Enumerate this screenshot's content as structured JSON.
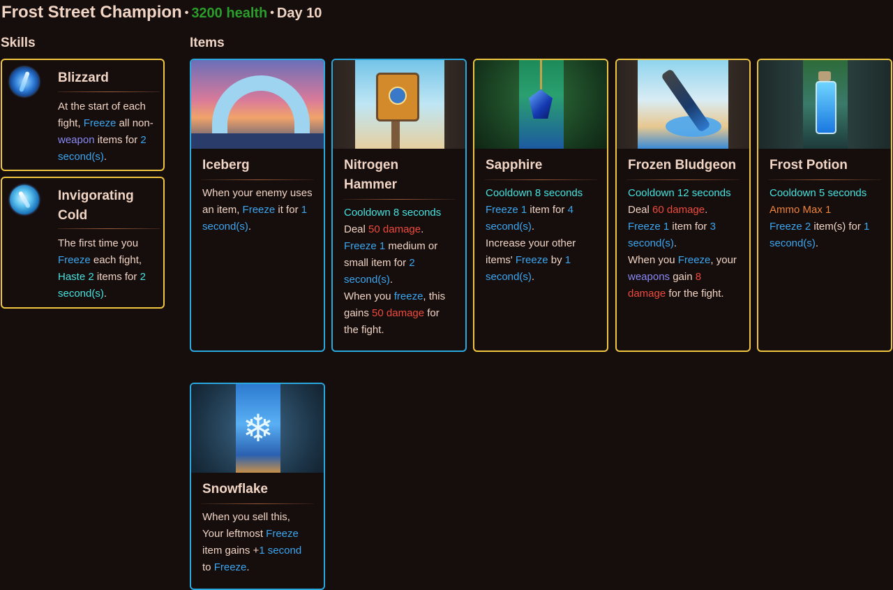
{
  "header": {
    "name": "Frost Street Champion",
    "separator": "•",
    "health": "3200 health",
    "day": "Day 10"
  },
  "colors": {
    "background": "#160d0d",
    "text": "#f1d5c5",
    "health": "#2a9d2a",
    "border_blue": "#29a9e0",
    "border_gold": "#f1c641",
    "freeze": "#3ba7f0",
    "cooldown": "#46e3e0",
    "damage": "#ef4b3c",
    "weapon": "#8a8af6",
    "ammo": "#f0843a"
  },
  "skills_label": "Skills",
  "items_label": "Items",
  "skills": [
    {
      "title": "Blizzard",
      "icon": "blizzard-icon",
      "desc": [
        {
          "t": "At the start of each fight, "
        },
        {
          "t": "Freeze",
          "c": "k-freeze"
        },
        {
          "t": " all non-"
        },
        {
          "t": "weapon",
          "c": "k-weapon"
        },
        {
          "t": " items for "
        },
        {
          "t": "2 second(s)",
          "c": "k-num"
        },
        {
          "t": "."
        }
      ]
    },
    {
      "title": "Invigorating Cold",
      "icon": "invigorating-cold-icon",
      "desc": [
        {
          "t": "The first time you "
        },
        {
          "t": "Freeze",
          "c": "k-freeze"
        },
        {
          "t": " each fight, "
        },
        {
          "t": "Haste 2",
          "c": "k-haste"
        },
        {
          "t": " items for "
        },
        {
          "t": "2 second(s)",
          "c": "k-haste"
        },
        {
          "t": "."
        }
      ]
    }
  ],
  "items": [
    {
      "title": "Iceberg",
      "border": "blue",
      "art": "iceberg-art",
      "desc": [
        {
          "t": "When your enemy uses an item, "
        },
        {
          "t": "Freeze",
          "c": "k-freeze"
        },
        {
          "t": " it for "
        },
        {
          "t": "1 second(s)",
          "c": "k-num"
        },
        {
          "t": "."
        }
      ]
    },
    {
      "title": "Nitrogen Hammer",
      "border": "blue",
      "art": "nitrogen-hammer-art",
      "desc": [
        {
          "t": "Cooldown 8 seconds",
          "c": "k-cd",
          "br": true
        },
        {
          "t": "Deal "
        },
        {
          "t": "50 damage",
          "c": "k-dmg"
        },
        {
          "t": ".",
          "br": true
        },
        {
          "t": "Freeze 1",
          "c": "k-freeze"
        },
        {
          "t": " medium or small item for "
        },
        {
          "t": "2 second(s)",
          "c": "k-num"
        },
        {
          "t": ".",
          "br": true
        },
        {
          "t": "When you "
        },
        {
          "t": "freeze",
          "c": "k-freeze"
        },
        {
          "t": ", this gains "
        },
        {
          "t": "50 damage",
          "c": "k-dmg"
        },
        {
          "t": " for the fight."
        }
      ]
    },
    {
      "title": "Sapphire",
      "border": "gold",
      "art": "sapphire-art",
      "desc": [
        {
          "t": "Cooldown 8 seconds",
          "c": "k-cd",
          "br": true
        },
        {
          "t": "Freeze 1",
          "c": "k-freeze"
        },
        {
          "t": " item for "
        },
        {
          "t": "4 second(s)",
          "c": "k-num"
        },
        {
          "t": ".",
          "br": true
        },
        {
          "t": "Increase your other items' "
        },
        {
          "t": "Freeze",
          "c": "k-freeze"
        },
        {
          "t": " by "
        },
        {
          "t": "1 second(s)",
          "c": "k-num"
        },
        {
          "t": "."
        }
      ]
    },
    {
      "title": "Frozen Bludgeon",
      "border": "gold",
      "art": "frozen-bludgeon-art",
      "desc": [
        {
          "t": "Cooldown 12 seconds",
          "c": "k-cd",
          "br": true
        },
        {
          "t": "Deal "
        },
        {
          "t": "60 damage",
          "c": "k-dmg"
        },
        {
          "t": ".",
          "br": true
        },
        {
          "t": "Freeze 1",
          "c": "k-freeze"
        },
        {
          "t": " item for "
        },
        {
          "t": "3 second(s)",
          "c": "k-num"
        },
        {
          "t": ".",
          "br": true
        },
        {
          "t": "When you "
        },
        {
          "t": "Freeze",
          "c": "k-freeze"
        },
        {
          "t": ", your "
        },
        {
          "t": "weapons",
          "c": "k-weapon"
        },
        {
          "t": " gain "
        },
        {
          "t": "8 damage",
          "c": "k-dmg"
        },
        {
          "t": " for the fight."
        }
      ]
    },
    {
      "title": "Frost Potion",
      "border": "gold",
      "art": "frost-potion-art",
      "desc": [
        {
          "t": "Cooldown 5 seconds",
          "c": "k-cd",
          "br": true
        },
        {
          "t": "Ammo Max 1",
          "c": "k-ammo",
          "br": true
        },
        {
          "t": "Freeze 2",
          "c": "k-freeze"
        },
        {
          "t": " item(s) for "
        },
        {
          "t": "1 second(s)",
          "c": "k-num"
        },
        {
          "t": "."
        }
      ]
    },
    {
      "title": "Snowflake",
      "border": "blue",
      "art": "snowflake-art",
      "desc": [
        {
          "t": "When you sell this, Your leftmost "
        },
        {
          "t": "Freeze",
          "c": "k-freeze"
        },
        {
          "t": " item gains +"
        },
        {
          "t": "1 second",
          "c": "k-num"
        },
        {
          "t": " to "
        },
        {
          "t": "Freeze",
          "c": "k-freeze"
        },
        {
          "t": "."
        }
      ]
    }
  ]
}
